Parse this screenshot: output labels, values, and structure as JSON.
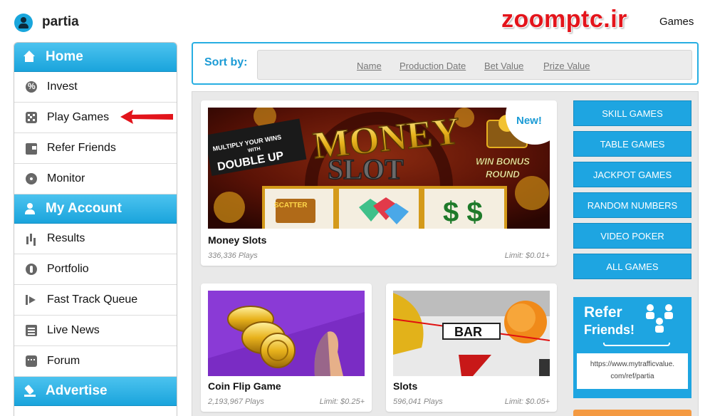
{
  "header": {
    "username": "partia",
    "brand": "zoomptc.ir",
    "section": "Games"
  },
  "sidebar": {
    "home": {
      "label": "Home",
      "icon": "home-icon"
    },
    "home_items": [
      {
        "label": "Invest",
        "icon": "percent-icon"
      },
      {
        "label": "Play Games",
        "icon": "dice-icon"
      },
      {
        "label": "Refer Friends",
        "icon": "wallet-icon"
      },
      {
        "label": "Monitor",
        "icon": "target-icon"
      }
    ],
    "account": {
      "label": "My Account",
      "icon": "user-icon"
    },
    "account_items": [
      {
        "label": "Results",
        "icon": "bar-chart-icon"
      },
      {
        "label": "Portfolio",
        "icon": "coin-icon"
      },
      {
        "label": "Fast Track Queue",
        "icon": "exit-arrow-icon"
      },
      {
        "label": "Live News",
        "icon": "newspaper-icon"
      },
      {
        "label": "Forum",
        "icon": "chat-icon"
      }
    ],
    "advertise": {
      "label": "Advertise",
      "icon": "gavel-icon"
    }
  },
  "sort": {
    "label": "Sort by:",
    "options": [
      "Name",
      "Production Date",
      "Bet Value",
      "Prize Value"
    ]
  },
  "games": [
    {
      "title": "Money Slots",
      "plays": "336,336 Plays",
      "limit": "Limit: $0.01+",
      "badge": "New!"
    },
    {
      "title": "Coin Flip Game",
      "plays": "2,193,967 Plays",
      "limit": "Limit: $0.25+"
    },
    {
      "title": "Slots",
      "plays": "596,041 Plays",
      "limit": "Limit: $0.05+"
    }
  ],
  "money_slot_art": {
    "banner_line1": "MULTIPLY YOUR WINS",
    "banner_line2": "WITH",
    "banner_line3": "DOUBLE UP",
    "logo_top": "MONEY",
    "logo_bottom": "SLOT",
    "bonus_line1": "WIN BONUS",
    "bonus_line2": "ROUND",
    "scatter": "SCATTER",
    "dollars": "$ $"
  },
  "slots_art": {
    "bar": "BAR"
  },
  "categories": [
    "SKILL GAMES",
    "TABLE GAMES",
    "JACKPOT GAMES",
    "RANDOM NUMBERS",
    "VIDEO POKER",
    "ALL GAMES"
  ],
  "refer": {
    "title": "Refer",
    "subtitle": "Friends!",
    "url_line1": "https://www.mytrafficvalue.",
    "url_line2": "com/ref/partia"
  },
  "colors": {
    "accent": "#1ea5e1",
    "brand_red": "#e4141b",
    "pointer_arrow": "#e2141b"
  }
}
